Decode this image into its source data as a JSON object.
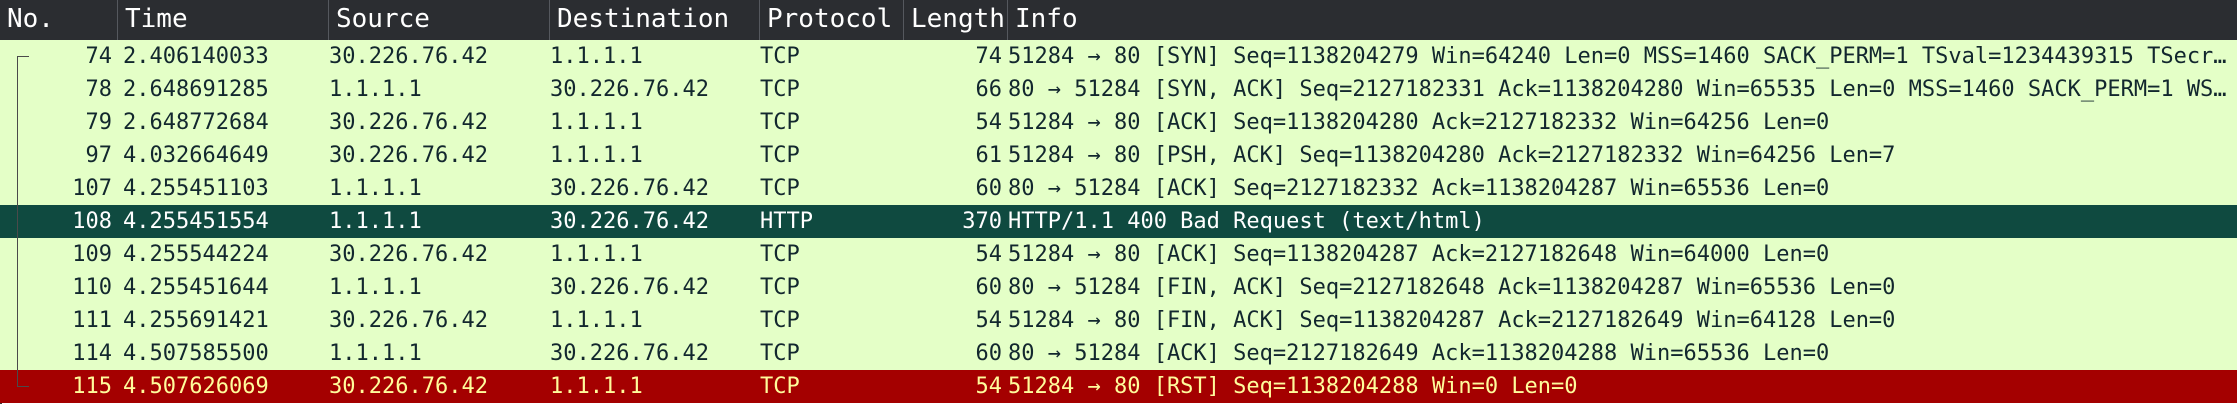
{
  "columns": {
    "no": "No.",
    "time": "Time",
    "source": "Source",
    "destination": "Destination",
    "protocol": "Protocol",
    "length": "Length",
    "info": "Info"
  },
  "packets": [
    {
      "no": "74",
      "time": "2.406140033",
      "source": "30.226.76.42",
      "destination": "1.1.1.1",
      "protocol": "TCP",
      "length": "74",
      "info": "51284 → 80 [SYN] Seq=1138204279 Win=64240 Len=0 MSS=1460 SACK_PERM=1 TSval=1234439315 TSecr…"
    },
    {
      "no": "78",
      "time": "2.648691285",
      "source": "1.1.1.1",
      "destination": "30.226.76.42",
      "protocol": "TCP",
      "length": "66",
      "info": "80 → 51284 [SYN, ACK] Seq=2127182331 Ack=1138204280 Win=65535 Len=0 MSS=1460 SACK_PERM=1 WS…"
    },
    {
      "no": "79",
      "time": "2.648772684",
      "source": "30.226.76.42",
      "destination": "1.1.1.1",
      "protocol": "TCP",
      "length": "54",
      "info": "51284 → 80 [ACK] Seq=1138204280 Ack=2127182332 Win=64256 Len=0"
    },
    {
      "no": "97",
      "time": "4.032664649",
      "source": "30.226.76.42",
      "destination": "1.1.1.1",
      "protocol": "TCP",
      "length": "61",
      "info": "51284 → 80 [PSH, ACK] Seq=1138204280 Ack=2127182332 Win=64256 Len=7"
    },
    {
      "no": "107",
      "time": "4.255451103",
      "source": "1.1.1.1",
      "destination": "30.226.76.42",
      "protocol": "TCP",
      "length": "60",
      "info": "80 → 51284 [ACK] Seq=2127182332 Ack=1138204287 Win=65536 Len=0"
    },
    {
      "no": "108",
      "time": "4.255451554",
      "source": "1.1.1.1",
      "destination": "30.226.76.42",
      "protocol": "HTTP",
      "length": "370",
      "info": "HTTP/1.1 400 Bad Request  (text/html)"
    },
    {
      "no": "109",
      "time": "4.255544224",
      "source": "30.226.76.42",
      "destination": "1.1.1.1",
      "protocol": "TCP",
      "length": "54",
      "info": "51284 → 80 [ACK] Seq=1138204287 Ack=2127182648 Win=64000 Len=0"
    },
    {
      "no": "110",
      "time": "4.255451644",
      "source": "1.1.1.1",
      "destination": "30.226.76.42",
      "protocol": "TCP",
      "length": "60",
      "info": "80 → 51284 [FIN, ACK] Seq=2127182648 Ack=1138204287 Win=65536 Len=0"
    },
    {
      "no": "111",
      "time": "4.255691421",
      "source": "30.226.76.42",
      "destination": "1.1.1.1",
      "protocol": "TCP",
      "length": "54",
      "info": "51284 → 80 [FIN, ACK] Seq=1138204287 Ack=2127182649 Win=64128 Len=0"
    },
    {
      "no": "114",
      "time": "4.507585500",
      "source": "1.1.1.1",
      "destination": "30.226.76.42",
      "protocol": "TCP",
      "length": "60",
      "info": "80 → 51284 [ACK] Seq=2127182649 Ack=1138204288 Win=65536 Len=0"
    },
    {
      "no": "115",
      "time": "4.507626069",
      "source": "30.226.76.42",
      "destination": "1.1.1.1",
      "protocol": "TCP",
      "length": "54",
      "info": "51284 → 80 [RST] Seq=1138204288 Win=0 Len=0"
    }
  ],
  "colors": {
    "header_bg": "#2b2d31",
    "tcp_bg": "#e4ffc7",
    "selected_bg": "#0f4a40",
    "rst_bg": "#a40000",
    "rst_fg": "#fffc9c"
  }
}
